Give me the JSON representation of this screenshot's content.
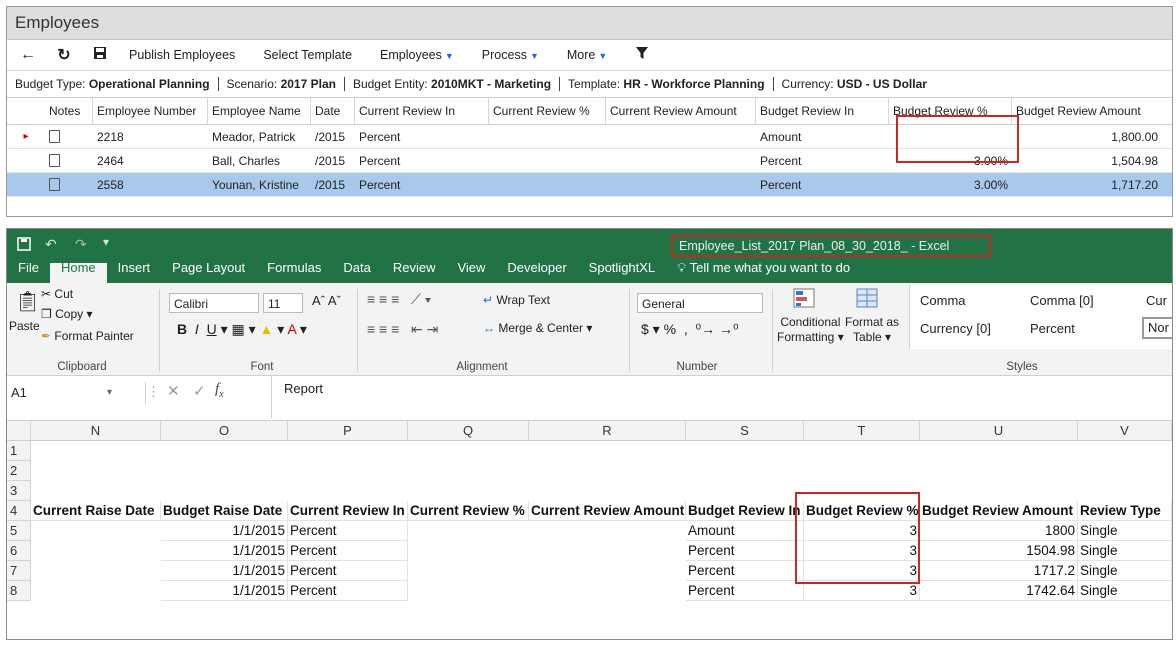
{
  "web": {
    "title": "Employees",
    "toolbar": {
      "publish": "Publish Employees",
      "select_template": "Select Template",
      "employees": "Employees",
      "process": "Process",
      "more": "More"
    },
    "context": {
      "budget_type_label": "Budget Type:",
      "budget_type": "Operational Planning",
      "scenario_label": "Scenario:",
      "scenario": "2017 Plan",
      "entity_label": "Budget Entity:",
      "entity": "2010MKT - Marketing",
      "template_label": "Template:",
      "template": "HR - Workforce Planning",
      "currency_label": "Currency:",
      "currency": "USD - US Dollar"
    },
    "columns": {
      "notes": "Notes",
      "emp_num": "Employee Number",
      "emp_name": "Employee Name",
      "date": "Date",
      "cur_review_in": "Current Review In",
      "cur_review_pct": "Current Review %",
      "cur_review_amt": "Current Review Amount",
      "bud_review_in": "Budget Review In",
      "bud_review_pct": "Budget Review %",
      "bud_review_amt": "Budget Review Amount"
    },
    "rows": [
      {
        "num": "2218",
        "name": "Meador, Patrick",
        "date": "/2015",
        "cur_in": "Percent",
        "bud_in": "Amount",
        "bud_pct": "",
        "bud_amt": "1,800.00"
      },
      {
        "num": "2464",
        "name": "Ball, Charles",
        "date": "/2015",
        "cur_in": "Percent",
        "bud_in": "Percent",
        "bud_pct": "3.00%",
        "bud_amt": "1,504.98"
      },
      {
        "num": "2558",
        "name": "Younan, Kristine",
        "date": "/2015",
        "cur_in": "Percent",
        "bud_in": "Percent",
        "bud_pct": "3.00%",
        "bud_amt": "1,717.20"
      }
    ]
  },
  "excel": {
    "title": "Employee_List_2017 Plan_08_30_2018_  - Excel",
    "tabs": [
      "File",
      "Home",
      "Insert",
      "Page Layout",
      "Formulas",
      "Data",
      "Review",
      "View",
      "Developer",
      "SpotlightXL"
    ],
    "tell_me": "Tell me what you want to do",
    "ribbon": {
      "cut": "Cut",
      "copy": "Copy",
      "paste": "Paste",
      "format_painter": "Format Painter",
      "clipboard": "Clipboard",
      "font_name": "Calibri",
      "font_size": "11",
      "font": "Font",
      "wrap_text": "Wrap Text",
      "merge_center": "Merge & Center",
      "alignment": "Alignment",
      "number_format": "General",
      "number": "Number",
      "conditional": "Conditional",
      "formatting": "Formatting",
      "format_as": "Format as",
      "table": "Table",
      "styles": "Styles",
      "style_comma": "Comma",
      "style_comma0": "Comma [0]",
      "style_cur": "Cur",
      "style_currency0": "Currency [0]",
      "style_percent": "Percent",
      "style_nor": "Nor"
    },
    "name_box": "A1",
    "formula": "Report",
    "columns": [
      "N",
      "O",
      "P",
      "Q",
      "R",
      "S",
      "T",
      "U",
      "V"
    ],
    "row_numbers": [
      "1",
      "2",
      "3",
      "4",
      "5",
      "6",
      "7",
      "8"
    ],
    "headers": [
      "Current Raise Date",
      "Budget Raise Date",
      "Current Review In",
      "Current Review %",
      "Current Review Amount",
      "Budget Review In",
      "Budget Review %",
      "Budget Review Amount",
      "Review Type"
    ],
    "rows": [
      [
        "",
        "1/1/2015",
        "Percent",
        "",
        "",
        "Amount",
        "3",
        "1800",
        "Single"
      ],
      [
        "",
        "1/1/2015",
        "Percent",
        "",
        "",
        "Percent",
        "3",
        "1504.98",
        "Single"
      ],
      [
        "",
        "1/1/2015",
        "Percent",
        "",
        "",
        "Percent",
        "3",
        "1717.2",
        "Single"
      ],
      [
        "",
        "1/1/2015",
        "Percent",
        "",
        "",
        "Percent",
        "3",
        "1742.64",
        "Single"
      ]
    ]
  }
}
